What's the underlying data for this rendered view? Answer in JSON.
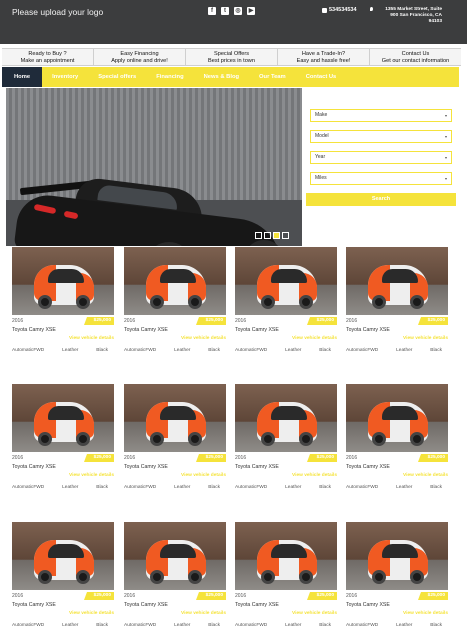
{
  "header": {
    "logo_text": "Please upload your logo",
    "social_icons": [
      "facebook-icon",
      "twitter-icon",
      "instagram-icon",
      "youtube-icon"
    ],
    "phone": "534534534",
    "address_line1": "1355 Market Street, Suite",
    "address_line2": "900 San Francisco, CA",
    "address_line3": "94103"
  },
  "promo": [
    {
      "title": "Ready to Buy ?",
      "subtitle": "Make an appointment"
    },
    {
      "title": "Easy Financing",
      "subtitle": "Apply online and drive!"
    },
    {
      "title": "Special Offers",
      "subtitle": "Best prices in town"
    },
    {
      "title": "Have a Trade-In?",
      "subtitle": "Easy and hassle free!"
    },
    {
      "title": "Contact Us",
      "subtitle": "Get our contact information"
    }
  ],
  "nav": [
    "Home",
    "Inventory",
    "Special offers",
    "Financing",
    "News & Blog",
    "Our Team",
    "Contact Us"
  ],
  "search": {
    "make": "Make",
    "model": "Model",
    "year": "Year",
    "miles": "Miles",
    "button": "Search"
  },
  "slider": {
    "dots": 4,
    "active": 2
  },
  "inventory": {
    "year": "2016",
    "price": "$25,000",
    "title": "Toyota Camry XSE",
    "details_link": "View vehicle details",
    "transmission": "Automatic",
    "drive": "FWD",
    "interior": "Leather",
    "color": "Black"
  },
  "colors": {
    "accent": "#f5e33b",
    "header_bg": "#3c3d3e",
    "nav_active": "#1f2b3a"
  }
}
